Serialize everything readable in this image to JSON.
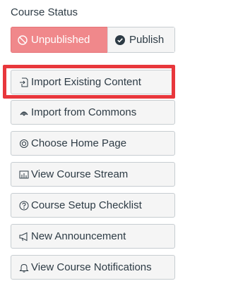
{
  "panel": {
    "title": "Course Status"
  },
  "status": {
    "unpublished_label": "Unpublished",
    "publish_label": "Publish",
    "unpublished_color": "#f0888b"
  },
  "actions": [
    {
      "label": "Import Existing Content",
      "icon": "import-icon"
    },
    {
      "label": "Import from Commons",
      "icon": "commons-icon"
    },
    {
      "label": "Choose Home Page",
      "icon": "settings-icon"
    },
    {
      "label": "View Course Stream",
      "icon": "stream-icon"
    },
    {
      "label": "Course Setup Checklist",
      "icon": "question-icon"
    },
    {
      "label": "New Announcement",
      "icon": "announcement-icon"
    },
    {
      "label": "View Course Notifications",
      "icon": "bell-icon"
    }
  ],
  "highlight_color": "#e8373c"
}
